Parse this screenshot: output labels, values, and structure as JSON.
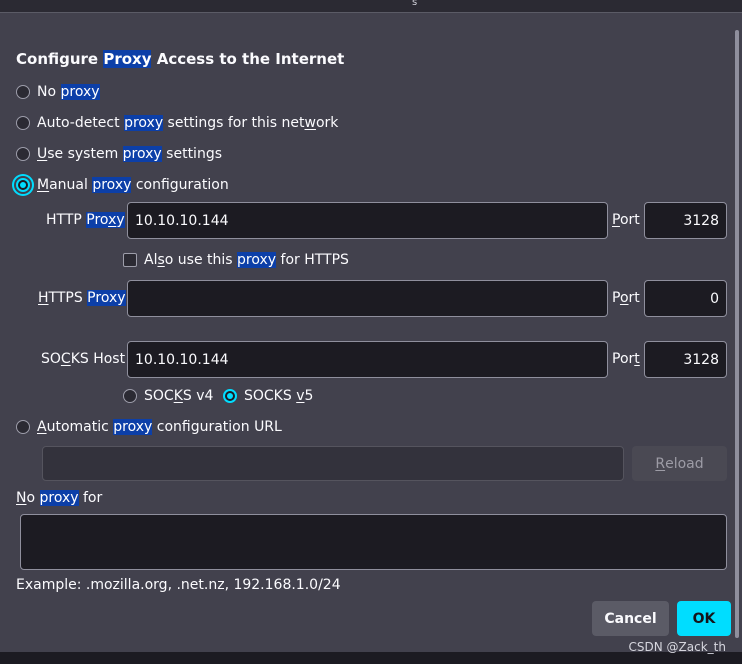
{
  "window": {
    "top_mark": "s"
  },
  "title": {
    "pre": "Configure ",
    "hl": "Proxy",
    "post": " Access to the Internet"
  },
  "options": {
    "no_proxy": {
      "pre": "No ",
      "hl": "proxy",
      "post": ""
    },
    "auto_detect": {
      "pre": "Auto-detect ",
      "hl": "proxy",
      "post1": " settings for this net",
      "u": "w",
      "post2": "ork"
    },
    "system": {
      "u": "U",
      "pre": "se system ",
      "hl": "proxy",
      "post": " settings"
    },
    "manual": {
      "u": "M",
      "pre": "anual ",
      "hl": "proxy",
      "post": " configuration",
      "selected": true
    },
    "auto_url": {
      "u": "A",
      "pre": "utomatic ",
      "hl": "proxy",
      "post": " configuration URL"
    }
  },
  "http": {
    "label_pre": "HTTP ",
    "label_hl_a": "Pro",
    "label_u": "x",
    "label_hl_b": "y",
    "value": "10.10.10.144",
    "port_label_u": "P",
    "port_label_rest": "ort",
    "port": "3128"
  },
  "also_https": {
    "pre": "Al",
    "u": "s",
    "mid": "o use this ",
    "hl": "proxy",
    "post": " for HTTPS",
    "checked": false
  },
  "https": {
    "label_u": "H",
    "label_pre": "TTPS ",
    "label_hl": "Proxy",
    "value": "",
    "port_label_pre": "P",
    "port_label_u": "o",
    "port_label_post": "rt",
    "port": "0"
  },
  "socks": {
    "label_pre": "SO",
    "label_u": "C",
    "label_post": "KS Host",
    "value": "10.10.10.144",
    "port_label_pre": "Por",
    "port_label_u": "t",
    "port": "3128",
    "v4": {
      "pre": "SOC",
      "u": "K",
      "post": "S v4",
      "selected": false
    },
    "v5": {
      "pre": "SOCKS ",
      "u": "v",
      "post": "5",
      "selected": true
    }
  },
  "auto_url_value": "",
  "reload_button": {
    "u": "R",
    "rest": "eload"
  },
  "no_proxy_for": {
    "u": "N",
    "pre": "o ",
    "hl": "proxy",
    "post": " for",
    "value": ""
  },
  "example": "Example: .mozilla.org, .net.nz, 192.168.1.0/24",
  "buttons": {
    "cancel": "Cancel",
    "ok": "OK"
  },
  "watermark": "CSDN @Zack_th",
  "colors": {
    "accent": "#00ddff",
    "highlight": "#0c3fa8",
    "background": "#42414d",
    "field": "#1c1b22"
  }
}
